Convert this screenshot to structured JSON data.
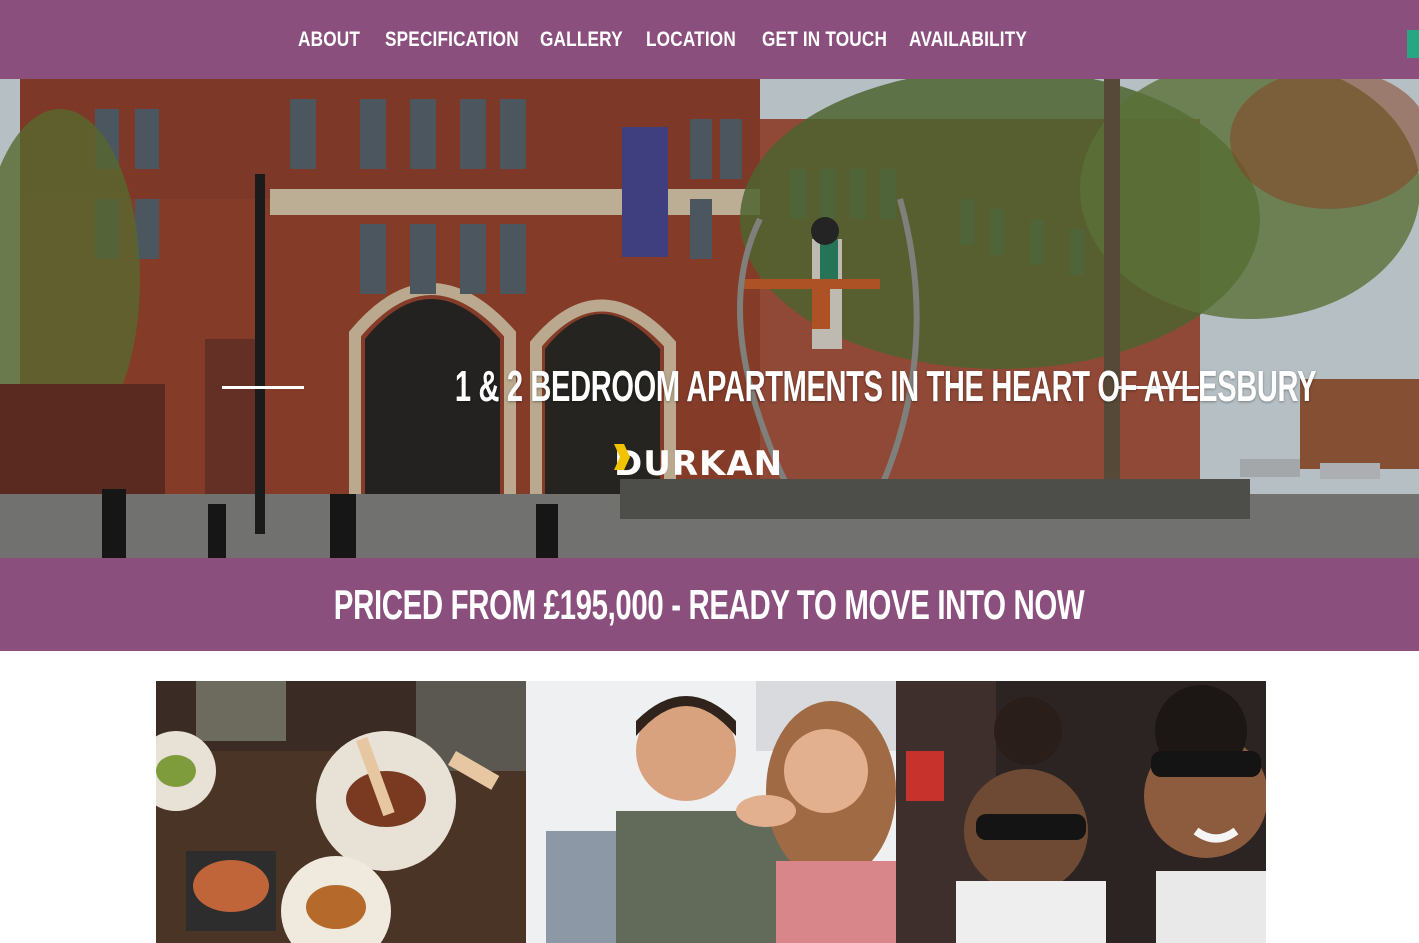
{
  "nav": {
    "items": [
      "ABOUT",
      "SPECIFICATION",
      "GALLERY",
      "LOCATION",
      "GET IN TOUCH",
      "AVAILABILITY"
    ]
  },
  "hero": {
    "headline": "1 & 2 BEDROOM APARTMENTS IN THE HEART OF AYLESBURY",
    "brand": "DURKAN"
  },
  "price_band": {
    "text": "PRICED FROM £195,000 - READY TO MOVE INTO NOW"
  },
  "colors": {
    "brand_purple": "#8a4f7d",
    "accent_green": "#26a784",
    "brand_mark_yellow": "#f2c300"
  },
  "tiles": [
    {
      "name": "dining-photo"
    },
    {
      "name": "couple-home-photo"
    },
    {
      "name": "cinema-photo"
    }
  ]
}
